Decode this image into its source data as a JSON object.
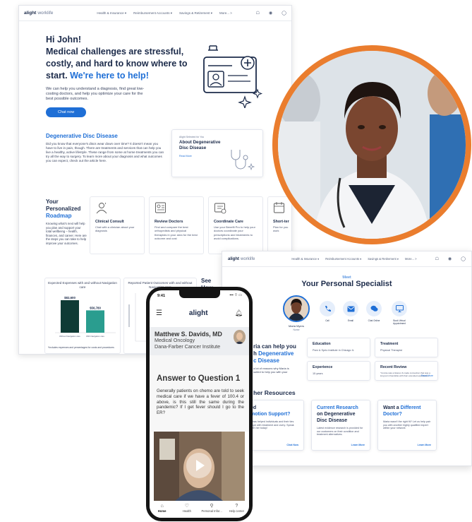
{
  "desktop": {
    "logo_brand": "alight",
    "logo_product": "worklife",
    "nav": [
      "Health & Insurance ▾",
      "Reimbursement Accounts ▾",
      "Savings & Retirement ▾",
      "More... >"
    ],
    "hero": {
      "greeting": "Hi John!",
      "headline_1": "Medical challenges are stressful, costly, and hard to know where to start.",
      "headline_accent": "We're here to help!",
      "body": "We can help you understand a diagnosis, find great low-costing doctors, and help you optimize your care for the best possible outcomes.",
      "cta": "Chat now"
    },
    "ddd": {
      "title": "Degenerative Disc Disease",
      "body": "Did you know that everyone's discs wear down over time? It doesn't mean you have to live in pain, though. There are treatments and services that can help you live a healthy, active lifestyle. These range from some at home treatments you can try all the way to surgery. To learn more about your diagnosis and what outcomes you can expect, check out the article here.",
      "card_kicker": "Alight Selected for You",
      "card_title": "About Degenerative Disc Disease",
      "card_link": "Read More"
    },
    "roadmap": {
      "title_1": "Your Personalized",
      "title_accent": "Roadmap",
      "body": "Knowing what's next will help you plan and support your total wellbeing – health, finances, and career. Here are the steps you can take to help improve your outcomes.",
      "cards": [
        {
          "title": "Clinical Consult",
          "desc": "Chat with a clinician about your diagnosis"
        },
        {
          "title": "Review Doctors",
          "desc": "Find and compare the best orthopedists and physical therapists in your area for the best outcome and cost"
        },
        {
          "title": "Coordinate Care",
          "desc": "Use your Benefit Pro to help your doctors coordinate your prescriptions and treatments to avoid complications."
        },
        {
          "title": "Short-ter",
          "desc": "Plan for you work"
        }
      ]
    },
    "charts": {
      "expenses_title": "Expected Expenses with and without Navigation care",
      "outcomes_title": "Reported Patient Outcomes with and without Navigation care",
      "see_how": "See How Fared",
      "footnote": "*Includes expenses and percentages for costs and procedures"
    }
  },
  "chart_data": [
    {
      "type": "bar",
      "title": "Expected Expenses with and without Navigation care",
      "categories": [
        "Without Navigation care",
        "With Navigation care"
      ],
      "values": [
        82600,
        56780
      ],
      "data_labels": [
        "$82,600",
        "$56,780"
      ],
      "colors": [
        "#0f3b35",
        "#2a9d8f"
      ]
    }
  ],
  "specialist": {
    "logo_brand": "alight",
    "logo_product": "worklife",
    "nav": [
      "Health & Insurance ▾",
      "Reimbursement Accounts ▾",
      "Savings & Retirement ▾",
      "More... >"
    ],
    "meet": "Meet",
    "title": "Your Personal Specialist",
    "name": "Maria Myers",
    "role": "Nurse",
    "actions": [
      "Call",
      "Email",
      "Chat Online",
      "Book Virtual Appointment"
    ],
    "education": {
      "h": "Education",
      "v": "Pam & Sprio Institute in Chicago IL"
    },
    "treatment": {
      "h": "Treatment",
      "v": "Physical Therapist"
    },
    "experience": {
      "h": "Experience",
      "v": "15 years"
    },
    "review": {
      "h": "Recent Review",
      "v": "\"Connie was a listener & made connection that was a long term friendship with their extended experience.\"",
      "more": "Read More"
    },
    "help_title_1": "ria can help you h",
    "help_title_accent": "Degenerative c Disease",
    "help_body": "a lot of reasons why Maria is suited to help you with your",
    "other_resources": "her Resources",
    "resources": [
      {
        "title_1": "ed",
        "title_accent": "motion Support?",
        "desc": "s has helped individuals and their ties cope with treatment and overy. Speak with her today!",
        "link": "Chat Now"
      },
      {
        "title_accent": "Current Research",
        "title_1": "on Degenerative Disc Disease",
        "desc": "Latest evidence research is provided for our customers on their condition and treatment alternatives.",
        "link": "Learn More"
      },
      {
        "title_1": "Want a",
        "title_accent": "Different Doctor?",
        "desc": "Maria wasn't the right fit? Let us help pair you with another highly qualified expert within your network",
        "link": "Learn More"
      }
    ]
  },
  "phone": {
    "time": "9:41",
    "signal": "▪▪▪ ⌔ ▭",
    "brand": "alight",
    "doctor_name": "Matthew S. Davids, MD",
    "doctor_dept": "Medical Oncology",
    "doctor_inst": "Dana-Farber Cancer Institute",
    "answer_title": "Answer to Question 1",
    "answer_text": "Generally patients on chemo are told to seek medical care if we have a fever of 100.4 or above, is this still the same during the pandemic? If I get fever should I go to the ER?",
    "tabs": [
      "Home",
      "Health",
      "Personal Infor...",
      "Help center"
    ]
  },
  "colors": {
    "accent": "#1f6fd6",
    "navy": "#1c2b4a",
    "orange_ring": "#ea7d2e",
    "teal": "#2a9d8f",
    "dark_teal": "#0f3b35"
  }
}
